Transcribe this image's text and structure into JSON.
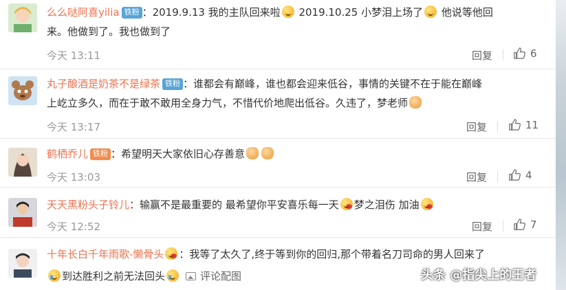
{
  "comments": [
    {
      "username": "么么哒阿喜yilia",
      "badge": "铁粉",
      "text_a": "：2019.9.13 我的主队回来啦",
      "text_b": " 2019.10.25 小梦泪上场了",
      "text_c": " 他说等他回",
      "text_line2": "来。他做到了。我也做到了",
      "time": "今天 13:11",
      "reply": "回复",
      "likes": "6"
    },
    {
      "username": "丸子酿酒是奶茶不是绿茶",
      "badge": "铁粉",
      "text_a": "：谁都会有巅峰，谁也都会迎来低谷，事情的关键不在于能在巅峰",
      "text_line2": "上屹立多久，而在于敢不敢用全身力气，不惜代价地爬出低谷。久违了，梦老师",
      "time": "今天 13:17",
      "reply": "回复",
      "likes": "11"
    },
    {
      "username": "鹤栖乔儿",
      "badge": "铁粉",
      "text_a": "：希望明天大家依旧心存善意",
      "time": "今天 13:03",
      "reply": "回复",
      "likes": "4"
    },
    {
      "username": "天天黑粉头子铃儿",
      "text_a": "：输赢不是最重要的 最希望你平安喜乐每一天",
      "text_b": "梦之泪伤 加油",
      "time": "今天 12:52",
      "reply": "回复",
      "likes": "7"
    },
    {
      "username": "十年长白千年雨歌-懒骨头",
      "text_a": "：我等了太久了,终于等到你的回归,那个带着名刀司命的男人回来了",
      "text_line2": "到达胜利之前无法回头",
      "pic_link": "评论配图"
    }
  ],
  "watermark": "头条 @指尖上的王者",
  "colors": {
    "username": "#eb7350",
    "badge_blue": "#58a4d6",
    "badge_orange": "#f28c4f",
    "meta_gray": "#999999"
  },
  "icons": [
    "thumbs-up-icon",
    "picture-icon",
    "emoji-icon"
  ]
}
